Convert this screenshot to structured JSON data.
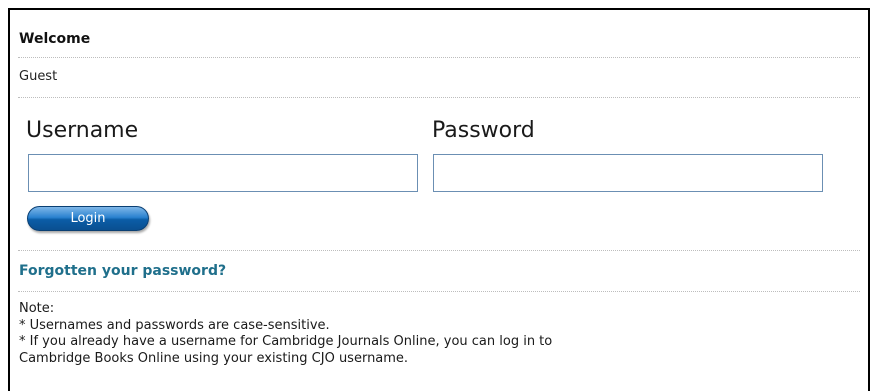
{
  "welcome": {
    "title": "Welcome",
    "user": "Guest"
  },
  "login_form": {
    "username_label": "Username",
    "password_label": "Password",
    "username_value": "",
    "password_value": "",
    "login_button": "Login"
  },
  "forgot_password_link": "Forgotten your password?",
  "note": {
    "heading": "Note:",
    "lines": [
      "* Usernames and passwords are case-sensitive.",
      "* If you already have a username for Cambridge Journals Online, you can log in to",
      "Cambridge Books Online using your existing CJO username."
    ]
  },
  "colors": {
    "link": "#1f6f8b",
    "button_blue": "#0b5da7",
    "input_border": "#6b8fb3"
  }
}
